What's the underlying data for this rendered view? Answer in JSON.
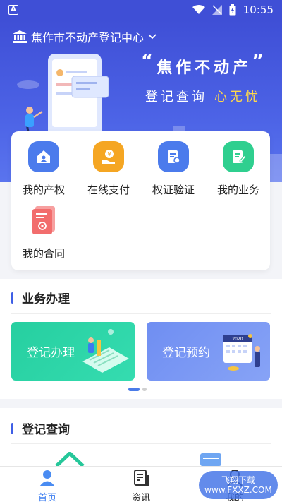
{
  "status_bar": {
    "time": "10:55"
  },
  "header": {
    "location": "焦作市不动产登记中心",
    "slogan_line1": "焦作不动产",
    "slogan_line2a": "登记查询",
    "slogan_line2b": "心无忧"
  },
  "quick_actions": [
    {
      "label": "我的产权",
      "icon": "home-icon",
      "color": "#4b7bec"
    },
    {
      "label": "在线支付",
      "icon": "payment-icon",
      "color": "#f5a623"
    },
    {
      "label": "权证验证",
      "icon": "certificate-icon",
      "color": "#4b7bec"
    },
    {
      "label": "我的业务",
      "icon": "document-edit-icon",
      "color": "#2fcf8f"
    },
    {
      "label": "我的合同",
      "icon": "contract-icon",
      "color": "#f26d6d"
    }
  ],
  "business": {
    "title": "业务办理",
    "cards": [
      {
        "label": "登记办理",
        "color": "#2ed3a5"
      },
      {
        "label": "登记预约",
        "color": "#6e8cf0"
      }
    ]
  },
  "query": {
    "title": "登记查询"
  },
  "tabbar": [
    {
      "label": "首页",
      "icon": "home-person-icon",
      "active": true
    },
    {
      "label": "资讯",
      "icon": "news-icon",
      "active": false
    },
    {
      "label": "我的",
      "icon": "user-icon",
      "active": false
    }
  ],
  "watermark": "飞翔下载 www.FXXZ.COM"
}
